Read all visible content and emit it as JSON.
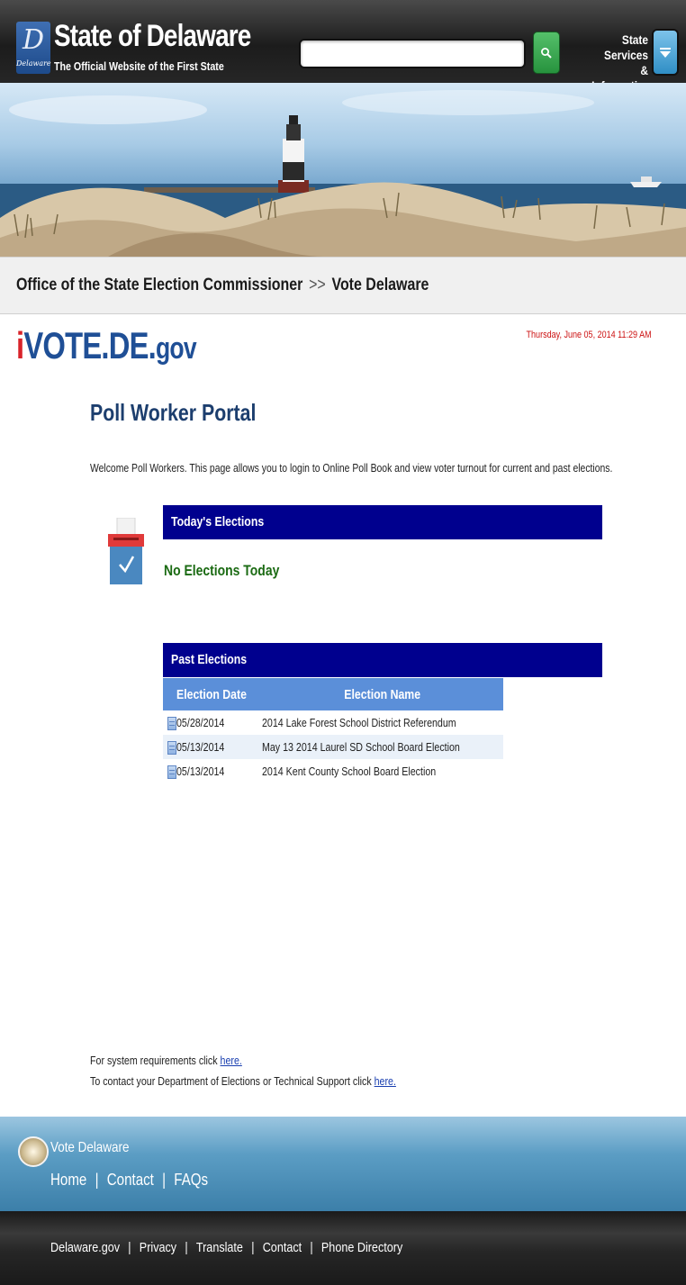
{
  "header": {
    "seal_label": "Delaware",
    "title": "State of Delaware",
    "tagline": "The Official Website of the First State",
    "search_value": "",
    "services_line1": "State Services",
    "services_line2": "& Information"
  },
  "breadcrumb": {
    "items": [
      "Office of the State Election Commissioner",
      "Vote Delaware"
    ],
    "separator": ">>"
  },
  "logo": {
    "prefix": "i",
    "main": "VOTE.DE.",
    "suffix": "gov"
  },
  "datetime": "Thursday, June 05, 2014 11:29 AM",
  "page_title": "Poll Worker Portal",
  "welcome": "Welcome Poll Workers. This page allows you to login to Online  Poll  Book and view voter turnout for current and past elections.",
  "today": {
    "heading": "Today's Elections",
    "message": "No Elections Today"
  },
  "past": {
    "heading": "Past Elections",
    "columns": [
      "Election Date",
      "Election Name"
    ],
    "rows": [
      {
        "date": "05/28/2014",
        "name": "2014 Lake Forest School District Referendum"
      },
      {
        "date": "05/13/2014",
        "name": "May 13 2014 Laurel SD School Board Election"
      },
      {
        "date": "05/13/2014",
        "name": "2014 Kent County School Board Election"
      }
    ]
  },
  "notes": {
    "sysreq_text": "For system requirements click ",
    "sysreq_link": "here.",
    "contact_text": "To contact your Department of Elections or Technical Support click ",
    "contact_link": "here."
  },
  "footer": {
    "title": "Vote Delaware",
    "links": [
      "Home",
      "Contact",
      "FAQs"
    ]
  },
  "bottom_links": [
    "Delaware.gov",
    "Privacy",
    "Translate",
    "Contact",
    "Phone Directory"
  ],
  "colors": {
    "section_bar": "#00008e",
    "table_header": "#5b8fd9",
    "no_elections": "#1a6a12",
    "datetime": "#cc1111",
    "logo_red": "#d8232a",
    "logo_blue": "#1f4f96"
  },
  "icons": [
    "search-icon",
    "chevron-down-icon",
    "ballot-box-icon",
    "document-icon",
    "state-seal-icon"
  ]
}
